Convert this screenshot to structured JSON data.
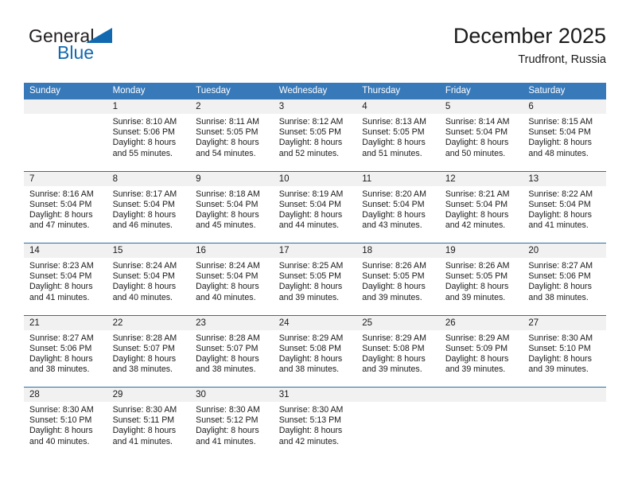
{
  "brand": {
    "name_part1": "General",
    "name_part2": "Blue",
    "logo_icon": "triangle-flag-icon"
  },
  "header": {
    "title": "December 2025",
    "subtitle": "Trudfront, Russia"
  },
  "weekdays": [
    "Sunday",
    "Monday",
    "Tuesday",
    "Wednesday",
    "Thursday",
    "Friday",
    "Saturday"
  ],
  "colors": {
    "header_blue": "#3879b9",
    "separator_blue": "#2e6da4",
    "daynum_band": "#f1f1f1",
    "brand_blue": "#1269b0",
    "text": "#1a1a1a"
  },
  "weeks": [
    [
      {
        "day": "",
        "lines": []
      },
      {
        "day": "1",
        "lines": [
          "Sunrise: 8:10 AM",
          "Sunset: 5:06 PM",
          "Daylight: 8 hours",
          "and 55 minutes."
        ]
      },
      {
        "day": "2",
        "lines": [
          "Sunrise: 8:11 AM",
          "Sunset: 5:05 PM",
          "Daylight: 8 hours",
          "and 54 minutes."
        ]
      },
      {
        "day": "3",
        "lines": [
          "Sunrise: 8:12 AM",
          "Sunset: 5:05 PM",
          "Daylight: 8 hours",
          "and 52 minutes."
        ]
      },
      {
        "day": "4",
        "lines": [
          "Sunrise: 8:13 AM",
          "Sunset: 5:05 PM",
          "Daylight: 8 hours",
          "and 51 minutes."
        ]
      },
      {
        "day": "5",
        "lines": [
          "Sunrise: 8:14 AM",
          "Sunset: 5:04 PM",
          "Daylight: 8 hours",
          "and 50 minutes."
        ]
      },
      {
        "day": "6",
        "lines": [
          "Sunrise: 8:15 AM",
          "Sunset: 5:04 PM",
          "Daylight: 8 hours",
          "and 48 minutes."
        ]
      }
    ],
    [
      {
        "day": "7",
        "lines": [
          "Sunrise: 8:16 AM",
          "Sunset: 5:04 PM",
          "Daylight: 8 hours",
          "and 47 minutes."
        ]
      },
      {
        "day": "8",
        "lines": [
          "Sunrise: 8:17 AM",
          "Sunset: 5:04 PM",
          "Daylight: 8 hours",
          "and 46 minutes."
        ]
      },
      {
        "day": "9",
        "lines": [
          "Sunrise: 8:18 AM",
          "Sunset: 5:04 PM",
          "Daylight: 8 hours",
          "and 45 minutes."
        ]
      },
      {
        "day": "10",
        "lines": [
          "Sunrise: 8:19 AM",
          "Sunset: 5:04 PM",
          "Daylight: 8 hours",
          "and 44 minutes."
        ]
      },
      {
        "day": "11",
        "lines": [
          "Sunrise: 8:20 AM",
          "Sunset: 5:04 PM",
          "Daylight: 8 hours",
          "and 43 minutes."
        ]
      },
      {
        "day": "12",
        "lines": [
          "Sunrise: 8:21 AM",
          "Sunset: 5:04 PM",
          "Daylight: 8 hours",
          "and 42 minutes."
        ]
      },
      {
        "day": "13",
        "lines": [
          "Sunrise: 8:22 AM",
          "Sunset: 5:04 PM",
          "Daylight: 8 hours",
          "and 41 minutes."
        ]
      }
    ],
    [
      {
        "day": "14",
        "lines": [
          "Sunrise: 8:23 AM",
          "Sunset: 5:04 PM",
          "Daylight: 8 hours",
          "and 41 minutes."
        ]
      },
      {
        "day": "15",
        "lines": [
          "Sunrise: 8:24 AM",
          "Sunset: 5:04 PM",
          "Daylight: 8 hours",
          "and 40 minutes."
        ]
      },
      {
        "day": "16",
        "lines": [
          "Sunrise: 8:24 AM",
          "Sunset: 5:04 PM",
          "Daylight: 8 hours",
          "and 40 minutes."
        ]
      },
      {
        "day": "17",
        "lines": [
          "Sunrise: 8:25 AM",
          "Sunset: 5:05 PM",
          "Daylight: 8 hours",
          "and 39 minutes."
        ]
      },
      {
        "day": "18",
        "lines": [
          "Sunrise: 8:26 AM",
          "Sunset: 5:05 PM",
          "Daylight: 8 hours",
          "and 39 minutes."
        ]
      },
      {
        "day": "19",
        "lines": [
          "Sunrise: 8:26 AM",
          "Sunset: 5:05 PM",
          "Daylight: 8 hours",
          "and 39 minutes."
        ]
      },
      {
        "day": "20",
        "lines": [
          "Sunrise: 8:27 AM",
          "Sunset: 5:06 PM",
          "Daylight: 8 hours",
          "and 38 minutes."
        ]
      }
    ],
    [
      {
        "day": "21",
        "lines": [
          "Sunrise: 8:27 AM",
          "Sunset: 5:06 PM",
          "Daylight: 8 hours",
          "and 38 minutes."
        ]
      },
      {
        "day": "22",
        "lines": [
          "Sunrise: 8:28 AM",
          "Sunset: 5:07 PM",
          "Daylight: 8 hours",
          "and 38 minutes."
        ]
      },
      {
        "day": "23",
        "lines": [
          "Sunrise: 8:28 AM",
          "Sunset: 5:07 PM",
          "Daylight: 8 hours",
          "and 38 minutes."
        ]
      },
      {
        "day": "24",
        "lines": [
          "Sunrise: 8:29 AM",
          "Sunset: 5:08 PM",
          "Daylight: 8 hours",
          "and 38 minutes."
        ]
      },
      {
        "day": "25",
        "lines": [
          "Sunrise: 8:29 AM",
          "Sunset: 5:08 PM",
          "Daylight: 8 hours",
          "and 39 minutes."
        ]
      },
      {
        "day": "26",
        "lines": [
          "Sunrise: 8:29 AM",
          "Sunset: 5:09 PM",
          "Daylight: 8 hours",
          "and 39 minutes."
        ]
      },
      {
        "day": "27",
        "lines": [
          "Sunrise: 8:30 AM",
          "Sunset: 5:10 PM",
          "Daylight: 8 hours",
          "and 39 minutes."
        ]
      }
    ],
    [
      {
        "day": "28",
        "lines": [
          "Sunrise: 8:30 AM",
          "Sunset: 5:10 PM",
          "Daylight: 8 hours",
          "and 40 minutes."
        ]
      },
      {
        "day": "29",
        "lines": [
          "Sunrise: 8:30 AM",
          "Sunset: 5:11 PM",
          "Daylight: 8 hours",
          "and 41 minutes."
        ]
      },
      {
        "day": "30",
        "lines": [
          "Sunrise: 8:30 AM",
          "Sunset: 5:12 PM",
          "Daylight: 8 hours",
          "and 41 minutes."
        ]
      },
      {
        "day": "31",
        "lines": [
          "Sunrise: 8:30 AM",
          "Sunset: 5:13 PM",
          "Daylight: 8 hours",
          "and 42 minutes."
        ]
      },
      {
        "day": "",
        "lines": []
      },
      {
        "day": "",
        "lines": []
      },
      {
        "day": "",
        "lines": []
      }
    ]
  ]
}
